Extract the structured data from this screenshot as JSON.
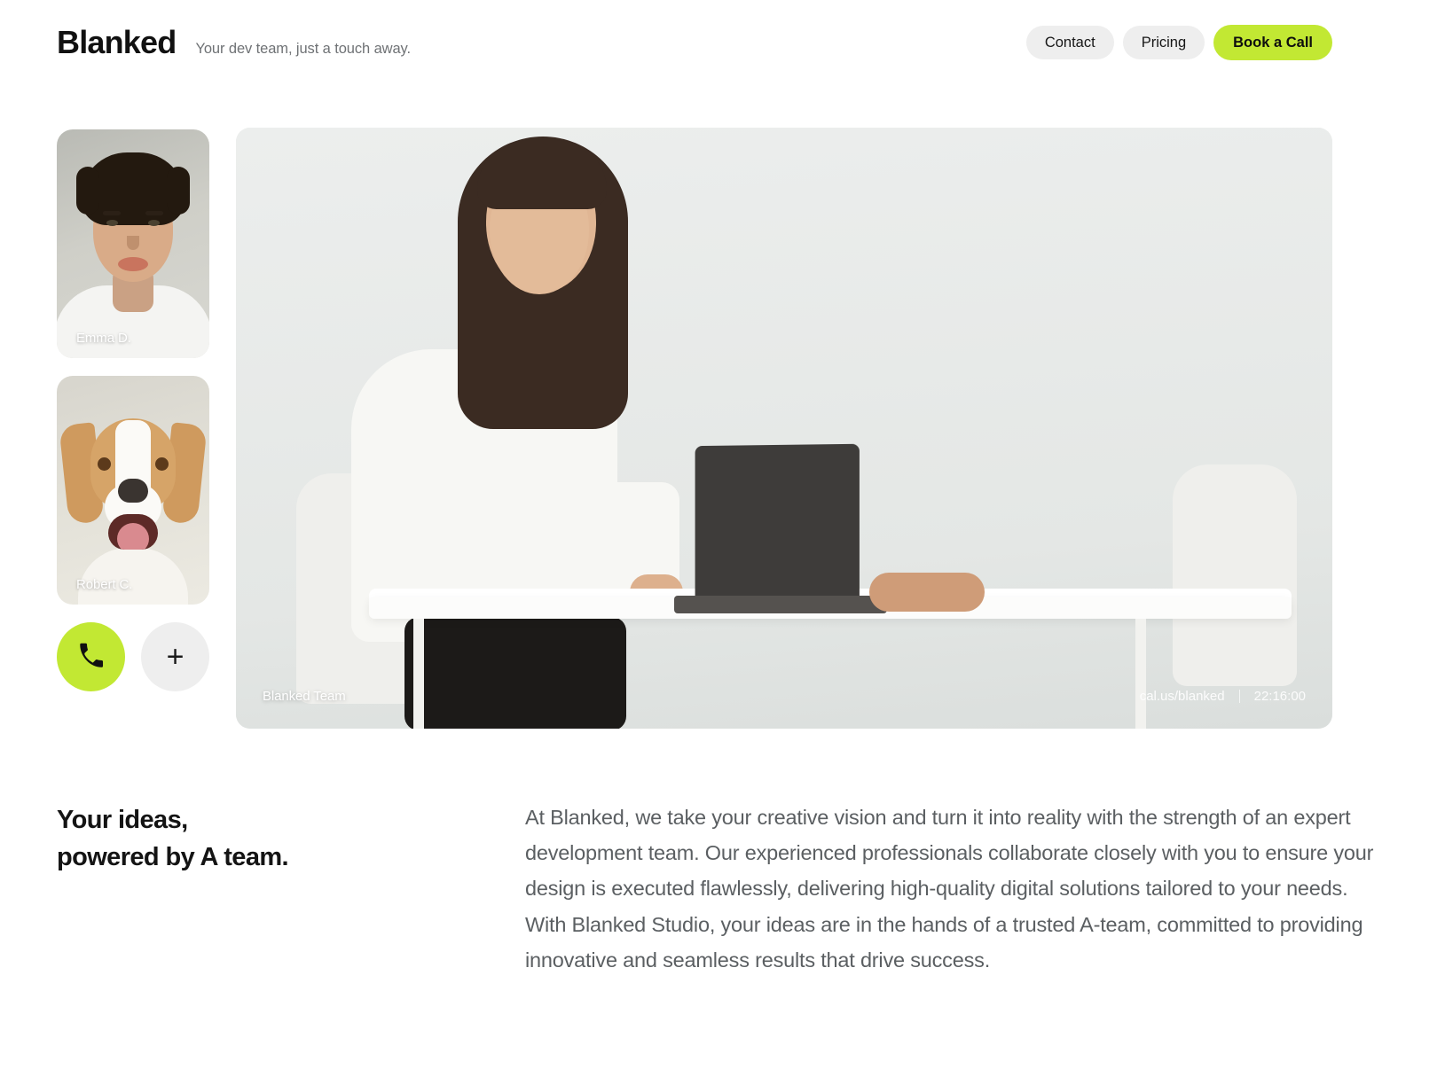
{
  "header": {
    "brand": "Blanked",
    "tagline": "Your dev team, just a touch away.",
    "nav": [
      {
        "label": "Contact",
        "style": "ghost"
      },
      {
        "label": "Pricing",
        "style": "ghost"
      },
      {
        "label": "Book a Call",
        "style": "cta"
      }
    ]
  },
  "colors": {
    "accent": "#c2e833",
    "pill_bg": "#eeeeee",
    "text_dark": "#141414",
    "text_muted": "#5b5f62"
  },
  "call": {
    "participants": [
      {
        "name": "Emma D.",
        "kind": "person-portrait"
      },
      {
        "name": "Robert C.",
        "kind": "dog-portrait"
      }
    ],
    "controls": [
      {
        "name": "phone-icon",
        "label": "",
        "style": "call"
      },
      {
        "name": "plus-icon",
        "label": "+",
        "style": "add"
      }
    ],
    "main_tile": {
      "label": "Blanked Team",
      "link": "cal.us/blanked",
      "timer": "22:16:00"
    }
  },
  "content": {
    "headline_line1": "Your ideas,",
    "headline_line2": "powered by A team.",
    "paragraph": "At Blanked, we take your creative vision and turn it into reality with the strength of an expert development team. Our experienced professionals collaborate closely with you to ensure your design is executed flawlessly, delivering high-quality digital solutions tailored to your needs. With Blanked Studio, your ideas are in the hands of a trusted A-team, committed to providing innovative and seamless results that drive success."
  }
}
